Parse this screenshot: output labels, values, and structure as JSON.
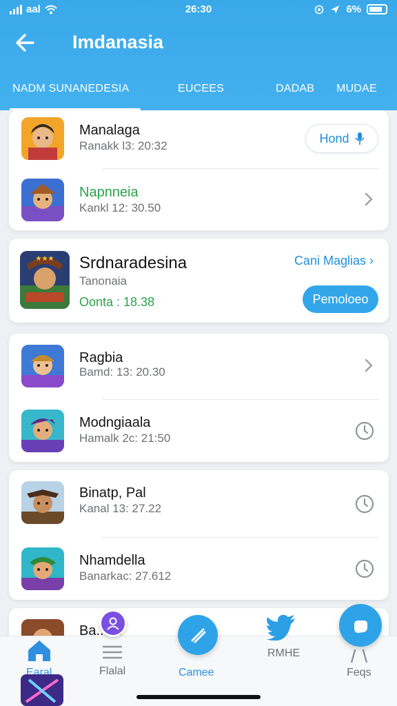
{
  "status_bar": {
    "carrier": "aal",
    "time": "26:30",
    "battery": "6%"
  },
  "header": {
    "title": "Imdanasia"
  },
  "tabs": [
    {
      "label": "NADM SUNANEDESIA"
    },
    {
      "label": "EUCEES"
    },
    {
      "label": "DADAB"
    },
    {
      "label": "MUDAE"
    }
  ],
  "cards": [
    {
      "rows": [
        {
          "name": "Manalaga",
          "meta": "Ranakk l3: 20:32",
          "action": "Hond"
        },
        {
          "name": "Napnneia",
          "meta": "Kankl 12: 30.50"
        }
      ]
    },
    {
      "featured": {
        "name": "Srdnaradesina",
        "sub": "Tanonaia",
        "meta": "Oonta : 18.38",
        "link": "Cani Maglias",
        "button": "Pemoloeo"
      }
    },
    {
      "rows": [
        {
          "name": "Ragbia",
          "meta": "Bamd: 13: 20.30"
        },
        {
          "name": "Modngiaala",
          "meta": "Hamalk 2c: 21:50"
        }
      ]
    },
    {
      "rows": [
        {
          "name": "Binatp, Pal",
          "meta": "Kanal 13: 27.22"
        },
        {
          "name": "Nhamdella",
          "meta": "Banarkac: 27.612"
        }
      ]
    },
    {
      "rows": [
        {
          "name": "Ba... al"
        }
      ]
    }
  ],
  "bottom_nav": [
    {
      "label": "Earal",
      "icon": "home-icon"
    },
    {
      "label": "Flalal",
      "icon": "menu-icon"
    },
    {
      "label": "Camee",
      "icon": "pen-icon"
    },
    {
      "label": "RMHE",
      "icon": "bird-icon"
    },
    {
      "label": "Feqs",
      "icon": "person-icon"
    }
  ],
  "colors": {
    "accent": "#3aa9ea",
    "green": "#2aa34a",
    "link": "#1f8fdc"
  }
}
